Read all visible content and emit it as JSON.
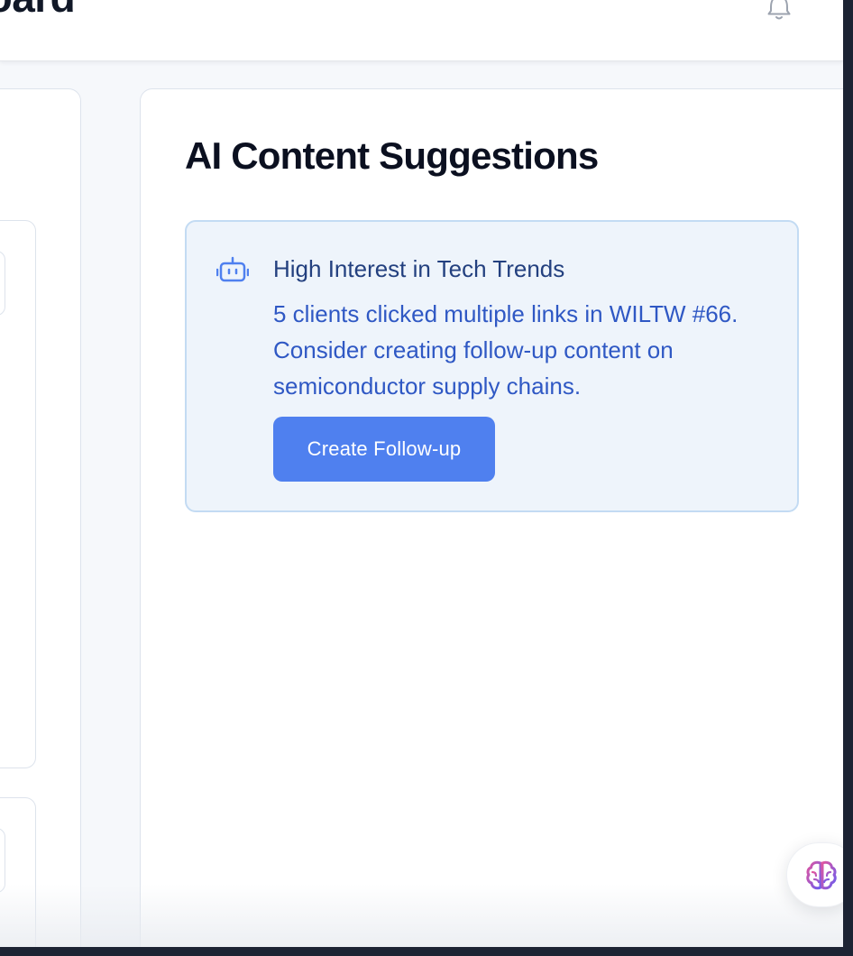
{
  "header": {
    "title": "board"
  },
  "ai_suggestions": {
    "title": "AI Content Suggestions",
    "card": {
      "icon": "robot-icon",
      "title": "High Interest in Tech Trends",
      "body": "5 clients clicked multiple links in WILTW #66. Consider creating follow-up content on semiconductor supply chains.",
      "button_label": "Create Follow-up"
    }
  },
  "fab": {
    "icon": "brain-icon"
  },
  "colors": {
    "accent": "#4f80ef",
    "card_bg": "#eef4fb",
    "card_border": "#c3dbf3",
    "title_text": "#23407f",
    "body_text": "#2f58c4"
  }
}
